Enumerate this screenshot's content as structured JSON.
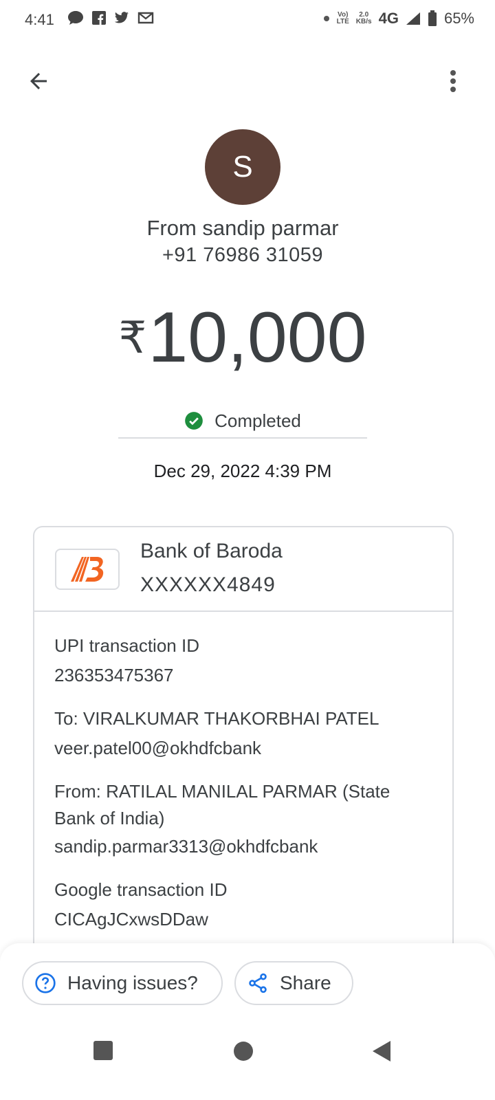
{
  "status_bar": {
    "time": "4:41",
    "volte_top": "Vo)",
    "volte_bottom": "LTE",
    "speed_top": "2.0",
    "speed_bottom": "KB/s",
    "network": "4G",
    "battery": "65%"
  },
  "header": {
    "back_icon": "arrow-back-icon",
    "menu_icon": "more-vert-icon"
  },
  "sender": {
    "avatar_letter": "S",
    "avatar_color": "#5d4037",
    "from_text": "From sandip parmar",
    "phone": "+91 76986 31059"
  },
  "amount": {
    "currency": "₹",
    "value": "10,000"
  },
  "status": {
    "label": "Completed",
    "color": "#1e8e3e"
  },
  "datetime": "Dec 29, 2022 4:39 PM",
  "bank": {
    "name": "Bank of Baroda",
    "account": "XXXXXX4849",
    "logo_color": "#f26522"
  },
  "details": {
    "upi_label": "UPI transaction ID",
    "upi_value": "236353475367",
    "to_label": "To: VIRALKUMAR THAKORBHAI PATEL",
    "to_value": "veer.patel00@okhdfcbank",
    "from_label_line1": "From: RATILAL MANILAL PARMAR (State",
    "from_label_line2": "Bank of India)",
    "from_value": "sandip.parmar3313@okhdfcbank",
    "google_label": "Google transaction ID",
    "google_value": "CICAgJCxwsDDaw"
  },
  "actions": {
    "issues_label": "Having issues?",
    "share_label": "Share",
    "accent": "#1a73e8"
  }
}
